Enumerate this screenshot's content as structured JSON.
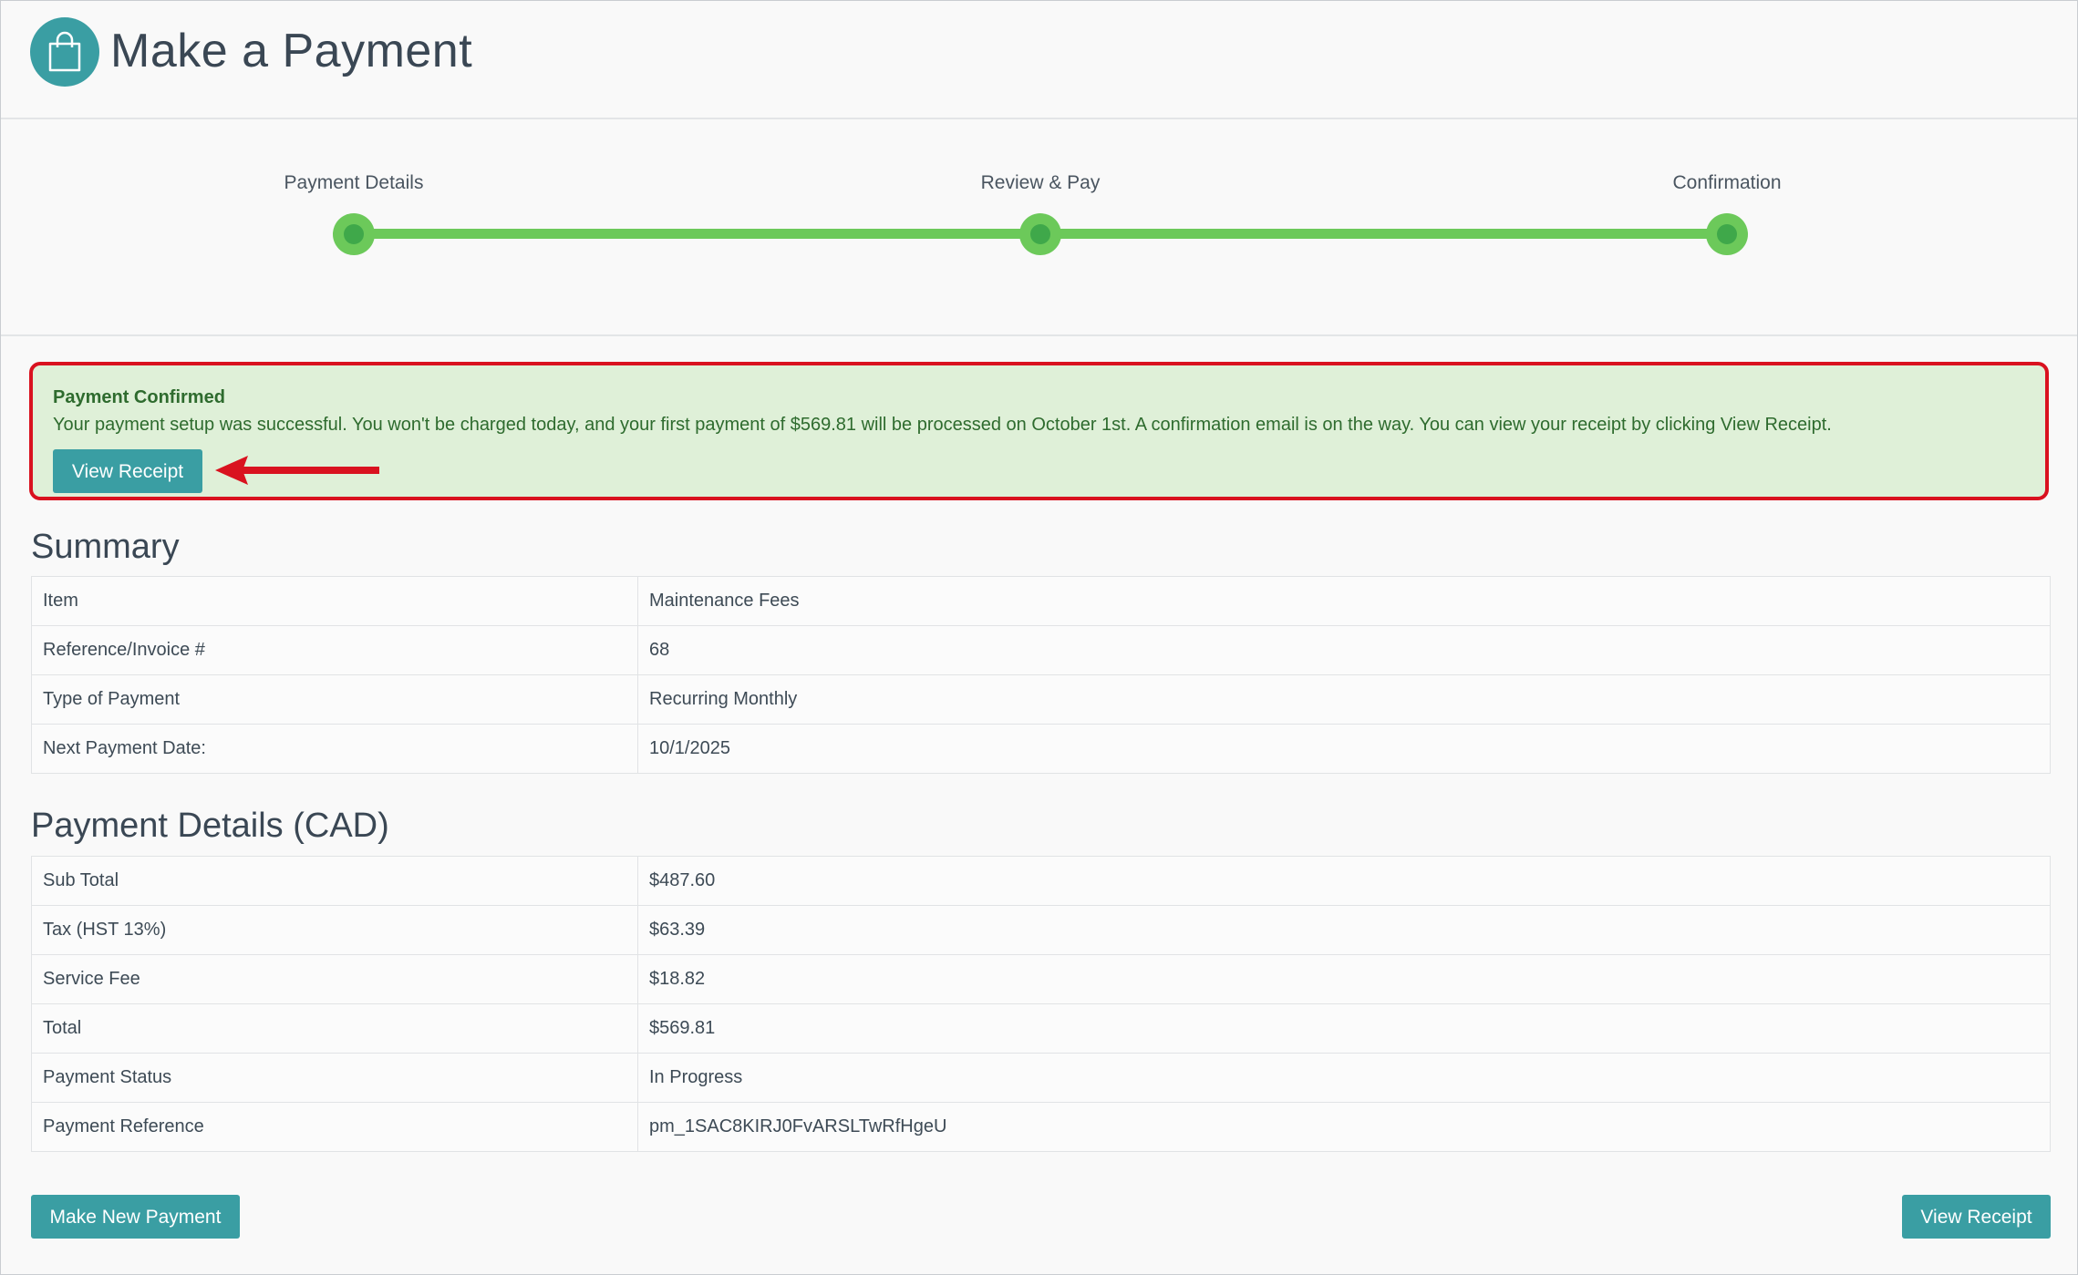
{
  "header": {
    "title": "Make a Payment",
    "icon": "shopping-bag-icon",
    "icon_color": "#3a9ea3"
  },
  "stepper": {
    "steps": [
      {
        "label": "Payment Details"
      },
      {
        "label": "Review & Pay"
      },
      {
        "label": "Confirmation"
      }
    ],
    "progress_color": "#6cc95a"
  },
  "alert": {
    "title": "Payment Confirmed",
    "message": "Your payment setup was successful. You won't be charged today, and your first payment of $569.81 will be processed on October 1st. A confirmation email is on the way. You can view your receipt by clicking View Receipt.",
    "button_label": "View Receipt",
    "background_color": "#dff0d8",
    "highlight_border_color": "#d9121f",
    "annotation_icon": "red-arrow-icon"
  },
  "summary": {
    "title": "Summary",
    "rows": [
      {
        "key": "Item",
        "value": "Maintenance Fees"
      },
      {
        "key": "Reference/Invoice #",
        "value": "68"
      },
      {
        "key": "Type of Payment",
        "value": "Recurring Monthly"
      },
      {
        "key": "Next Payment Date:",
        "value": "10/1/2025"
      }
    ]
  },
  "payment_details": {
    "title": "Payment Details (CAD)",
    "rows": [
      {
        "key": "Sub Total",
        "value": "$487.60"
      },
      {
        "key": "Tax (HST 13%)",
        "value": "$63.39"
      },
      {
        "key": "Service Fee",
        "value": "$18.82"
      },
      {
        "key": "Total",
        "value": "$569.81"
      },
      {
        "key": "Payment Status",
        "value": "In Progress"
      },
      {
        "key": "Payment Reference",
        "value": "pm_1SAC8KIRJ0FvARSLTwRfHgeU"
      }
    ]
  },
  "footer": {
    "new_payment_label": "Make New Payment",
    "view_receipt_label": "View Receipt",
    "button_color": "#3a9ea3"
  }
}
